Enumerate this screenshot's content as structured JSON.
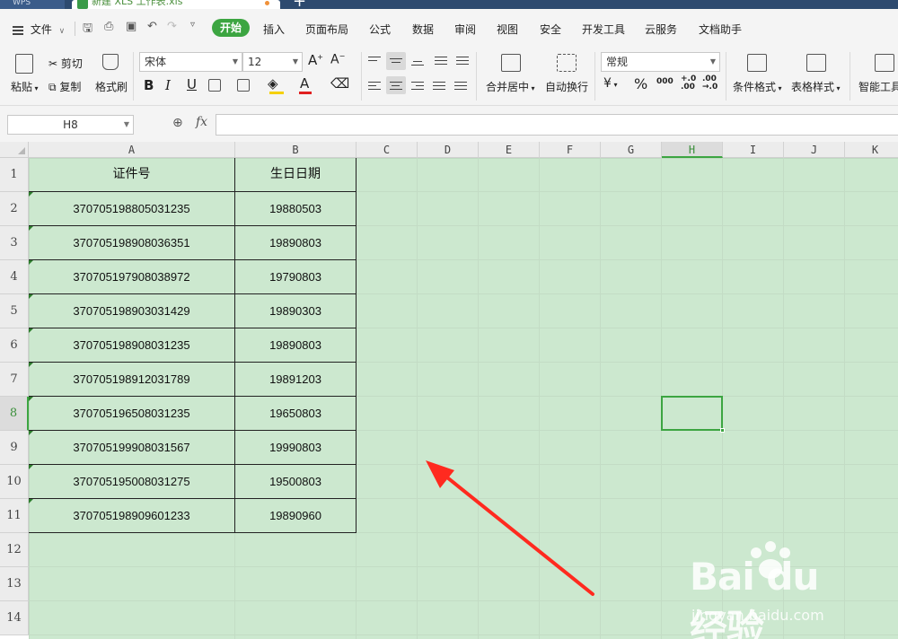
{
  "titlebar": {
    "app_label": "WPS",
    "file_tab": "新建 XLS 工作表.xls"
  },
  "menu": {
    "file_label": "文件",
    "tabs": [
      "开始",
      "插入",
      "页面布局",
      "公式",
      "数据",
      "审阅",
      "视图",
      "安全",
      "开发工具",
      "云服务",
      "文档助手"
    ],
    "active_tab": "开始"
  },
  "ribbon": {
    "paste": "粘贴",
    "cut": "剪切",
    "copy": "复制",
    "format_painter": "格式刷",
    "font_name": "宋体",
    "font_size": "12",
    "merge_center": "合并居中",
    "wrap_text": "自动换行",
    "number_format": "常规",
    "conditional_format": "条件格式",
    "table_style": "表格样式",
    "smart_tools": "智能工具",
    "percent": "%",
    "thousands": "000",
    "inc_decimal": "+.0\n.00",
    "dec_decimal": ".00\n→.0",
    "bold": "B",
    "italic": "I",
    "underline": "U"
  },
  "formula_bar": {
    "name_box": "H8",
    "fx": "fx",
    "formula": ""
  },
  "sheet": {
    "columns": [
      "A",
      "B",
      "C",
      "D",
      "E",
      "F",
      "G",
      "H",
      "I",
      "J",
      "K"
    ],
    "active_column": "H",
    "rows": [
      "1",
      "2",
      "3",
      "4",
      "5",
      "6",
      "7",
      "8",
      "9",
      "10",
      "11",
      "12",
      "13",
      "14"
    ],
    "active_row": "8",
    "headers": [
      "证件号",
      "生日日期"
    ],
    "data": [
      [
        "370705198805031235",
        "19880503"
      ],
      [
        "370705198908036351",
        "19890803"
      ],
      [
        "370705197908038972",
        "19790803"
      ],
      [
        "370705198903031429",
        "19890303"
      ],
      [
        "370705198908031235",
        "19890803"
      ],
      [
        "370705198912031789",
        "19891203"
      ],
      [
        "370705196508031235",
        "19650803"
      ],
      [
        "370705199908031567",
        "19990803"
      ],
      [
        "370705195008031275",
        "19500803"
      ],
      [
        "370705198909601233",
        "19890960"
      ]
    ]
  },
  "watermark": {
    "logo": "Bai du 经验",
    "url": "jingyan.baidu.com"
  },
  "colors": {
    "accent": "#3ca541",
    "sheet_bg": "#cce8cf",
    "arrow": "#ff2a1f"
  }
}
